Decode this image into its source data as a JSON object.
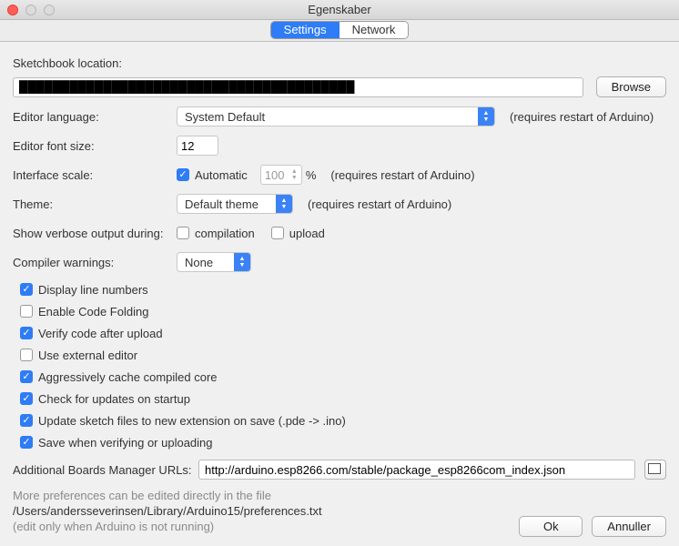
{
  "window": {
    "title": "Egenskaber"
  },
  "tabs": {
    "settings": "Settings",
    "network": "Network",
    "active": "settings"
  },
  "sketchbook": {
    "label": "Sketchbook location:",
    "value": "████████████████████████████████████████",
    "browse": "Browse"
  },
  "language": {
    "label": "Editor language:",
    "value": "System Default",
    "note": "(requires restart of Arduino)"
  },
  "fontsize": {
    "label": "Editor font size:",
    "value": "12"
  },
  "scale": {
    "label": "Interface scale:",
    "auto_checked": true,
    "auto_label": "Automatic",
    "value": "100",
    "percent": "%",
    "note": "(requires restart of Arduino)"
  },
  "theme": {
    "label": "Theme:",
    "value": "Default theme",
    "note": "(requires restart of Arduino)"
  },
  "verbose": {
    "label": "Show verbose output during:",
    "compilation_checked": false,
    "compilation_label": "compilation",
    "upload_checked": false,
    "upload_label": "upload"
  },
  "warnings": {
    "label": "Compiler warnings:",
    "value": "None"
  },
  "opts": [
    {
      "checked": true,
      "label": "Display line numbers"
    },
    {
      "checked": false,
      "label": "Enable Code Folding"
    },
    {
      "checked": true,
      "label": "Verify code after upload"
    },
    {
      "checked": false,
      "label": "Use external editor"
    },
    {
      "checked": true,
      "label": "Aggressively cache compiled core"
    },
    {
      "checked": true,
      "label": "Check for updates on startup"
    },
    {
      "checked": true,
      "label": "Update sketch files to new extension on save (.pde -> .ino)"
    },
    {
      "checked": true,
      "label": "Save when verifying or uploading"
    }
  ],
  "boards": {
    "label": "Additional Boards Manager URLs:",
    "value": "http://arduino.esp8266.com/stable/package_esp8266com_index.json"
  },
  "moreinfo": {
    "line1": "More preferences can be edited directly in the file",
    "path": "/Users/andersseverinsen/Library/Arduino15/preferences.txt",
    "line2": "(edit only when Arduino is not running)"
  },
  "buttons": {
    "ok": "Ok",
    "cancel": "Annuller"
  }
}
